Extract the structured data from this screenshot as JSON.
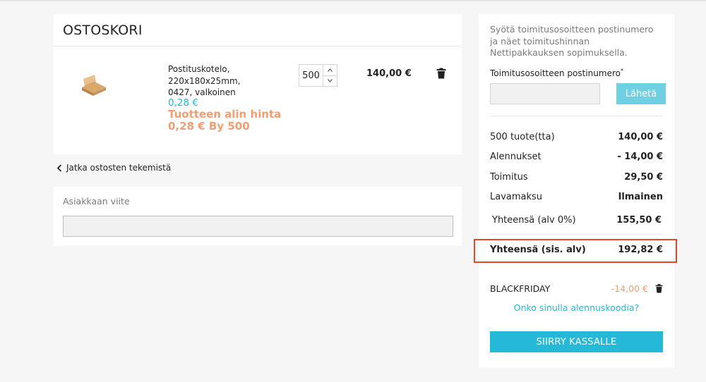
{
  "cart": {
    "title": "OSTOSKORI",
    "item": {
      "name": "Postituskotelo, 220x180x25mm, 0427, valkoinen",
      "unit_price": "0,28 €",
      "min_price_line1": "Tuotteen alin hinta",
      "min_price_line2": "0,28 € By 500",
      "quantity": "500",
      "line_total": "140,00 €"
    },
    "continue_label": "Jatka ostosten tekemistä"
  },
  "reference": {
    "label": "Asiakkaan viite",
    "value": ""
  },
  "shipping": {
    "info": "Syötä toimitusosoitteen postinumero ja näet toimitushinnan Nettipakkauksen sopimuksella.",
    "zip_label": "Toimitusosoitteen postinumero",
    "required_mark": "*",
    "zip_value": "",
    "send_label": "Lähetä"
  },
  "summary": {
    "rows": [
      {
        "label": "500 tuote(tta)",
        "value": "140,00 €"
      },
      {
        "label": "Alennukset",
        "value": "- 14,00 €"
      },
      {
        "label": "Toimitus",
        "value": "29,50 €"
      },
      {
        "label": "Lavamaksu",
        "value": "Ilmainen"
      },
      {
        "label": "Yhteensä (alv 0%)",
        "value": "155,50 €"
      }
    ],
    "grand_total_label": "Yhteensä (sis. alv)",
    "grand_total_value": "192,82 €",
    "voucher_code": "BLACKFRIDAY",
    "voucher_amount": "-14,00 €",
    "promo_link": "Onko sinulla alennuskoodia?",
    "checkout_label": "SIIRRY KASSALLE"
  },
  "colors": {
    "accent": "#25b9d7",
    "promo": "#f39d72",
    "highlight_border": "#e64827"
  }
}
